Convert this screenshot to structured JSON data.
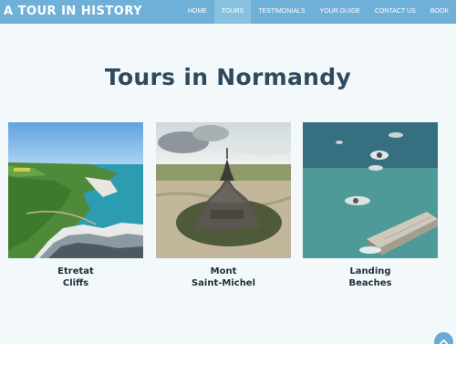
{
  "site": {
    "brand": "A TOUR IN HISTORY"
  },
  "nav": {
    "items": [
      {
        "label": "HOME"
      },
      {
        "label": "TOURS",
        "active": true
      },
      {
        "label": "TESTIMONIALS"
      },
      {
        "label": "YOUR GUIDE"
      },
      {
        "label": "CONTACT US"
      },
      {
        "label": "BOOK"
      }
    ]
  },
  "main": {
    "heading": "Tours in Normandy",
    "tours": [
      {
        "line1": "Etretat",
        "line2": "Cliffs",
        "image": "etretat-cliffs-photo"
      },
      {
        "line1": "Mont",
        "line2": "Saint-Michel",
        "image": "mont-saint-michel-photo"
      },
      {
        "line1": "Landing",
        "line2": "Beaches",
        "image": "landing-beaches-photo"
      }
    ]
  },
  "colors": {
    "navbar": "#6fb0d8",
    "nav_active": "#88c1e0",
    "heading": "#2e4a60",
    "page_background": "#f3f8fb",
    "scroll_button": "#6aaad6"
  },
  "icons": {
    "scroll_top": "chevron-up-icon"
  }
}
